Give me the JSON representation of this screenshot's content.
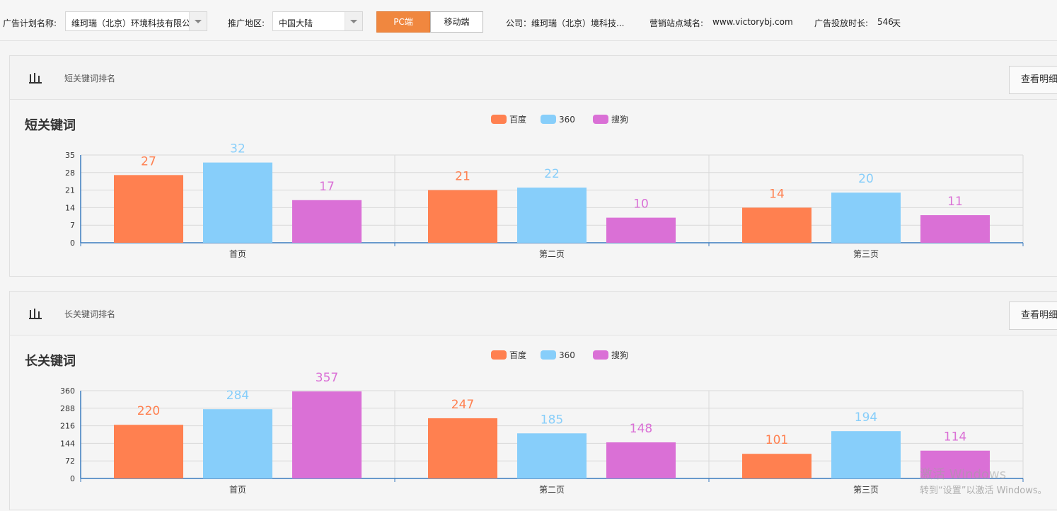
{
  "filters": {
    "plan_label": "广告计划名称:",
    "plan_value": "维珂瑞（北京）环境科技有限公",
    "region_label": "推广地区:",
    "region_value": "中国大陆",
    "pc_label": "PC端",
    "mobile_label": "移动端",
    "company_text": "公司：维珂瑞（北京）境科技...",
    "site_label": "营销站点域名:",
    "site_value": "www.victorybj.com",
    "duration_label": "广告投放时长:",
    "duration_value": "546",
    "duration_unit": "天"
  },
  "panels": [
    {
      "small_title": "短关键词排名",
      "chart_title": "短关键词",
      "detail_button": "查看明细"
    },
    {
      "small_title": "长关键词排名",
      "chart_title": "长关键词",
      "detail_button": "查看明细"
    }
  ],
  "colors": {
    "baidu": "#ff8050",
    "s360": "#87cefa",
    "sogou": "#da70d6",
    "axis": "#3a7bbf",
    "pc_active": "#f0873f",
    "link": "#f5a623"
  },
  "chart_data": [
    {
      "type": "bar",
      "title": "短关键词",
      "categories": [
        "首页",
        "第二页",
        "第三页"
      ],
      "series": [
        {
          "name": "百度",
          "values": [
            27,
            21,
            14
          ]
        },
        {
          "name": "360",
          "values": [
            32,
            22,
            20
          ]
        },
        {
          "name": "搜狗",
          "values": [
            17,
            10,
            11
          ]
        }
      ],
      "ylim": [
        0,
        35
      ],
      "yticks": [
        0,
        7,
        14,
        21,
        28,
        35
      ],
      "legend": "top-center",
      "grid": true
    },
    {
      "type": "bar",
      "title": "长关键词",
      "categories": [
        "首页",
        "第二页",
        "第三页"
      ],
      "series": [
        {
          "name": "百度",
          "values": [
            220,
            247,
            101
          ]
        },
        {
          "name": "360",
          "values": [
            284,
            185,
            194
          ]
        },
        {
          "name": "搜狗",
          "values": [
            357,
            148,
            114
          ]
        }
      ],
      "ylim": [
        0,
        360
      ],
      "yticks": [
        0,
        72,
        144,
        216,
        288,
        360
      ],
      "legend": "top-center",
      "grid": true
    }
  ],
  "watermark": {
    "line1": "激活 Windows",
    "line2": "转到“设置”以激活 Windows。"
  }
}
